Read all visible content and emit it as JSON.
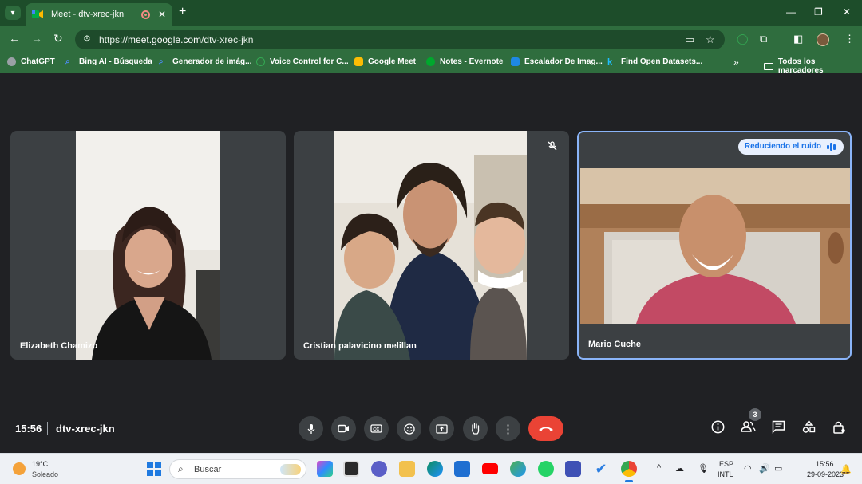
{
  "browser": {
    "tab_title": "Meet - dtv-xrec-jkn",
    "url_prefix": "https://",
    "url_host": "meet.google.com",
    "url_path": "/dtv-xrec-jkn",
    "bookmarks": [
      {
        "label": "ChatGPT",
        "color": "#9aa0a6"
      },
      {
        "label": "Bing AI - Búsqueda",
        "color": "#4c8bf5"
      },
      {
        "label": "Generador de imág...",
        "color": "#4c8bf5"
      },
      {
        "label": "Voice Control for C...",
        "color": "#34a853"
      },
      {
        "label": "Google Meet",
        "color": "#fbbc04"
      },
      {
        "label": "Notes - Evernote",
        "color": "#00a82d"
      },
      {
        "label": "Escalador De Imag...",
        "color": "#1e88e5"
      },
      {
        "label": "Find Open Datasets...",
        "color": "#20beff"
      }
    ],
    "all_bookmarks_label": "Todos los marcadores"
  },
  "meet": {
    "participants": [
      {
        "name": "Elizabeth Chamizo"
      },
      {
        "name": "Cristian palavicino melillan"
      },
      {
        "name": "Mario Cuche"
      }
    ],
    "noise_badge": "Reduciendo el ruido",
    "time": "15:56",
    "code": "dtv-xrec-jkn",
    "people_count": "3",
    "accent_color": "#8ab4f8",
    "end_call_color": "#ea4335"
  },
  "taskbar": {
    "temperature": "19°C",
    "condition": "Soleado",
    "search_placeholder": "Buscar",
    "lang_code": "ESP",
    "layout": "INTL",
    "clock_time": "15:56",
    "clock_date": "29-09-2023"
  }
}
